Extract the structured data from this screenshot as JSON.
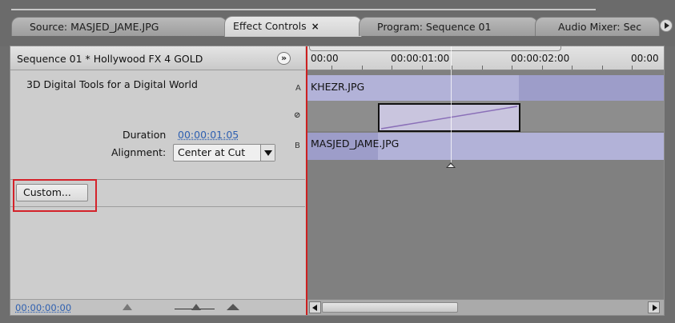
{
  "tabs": [
    {
      "label": "Source: MASJED_JAME.JPG"
    },
    {
      "label": "Effect Controls",
      "close": "×"
    },
    {
      "label": "Program: Sequence 01"
    },
    {
      "label": "Audio Mixer: Sec"
    }
  ],
  "effect_header": {
    "label": "Sequence 01 * Hollywood FX 4 GOLD",
    "toggle_glyph": "»"
  },
  "effect": {
    "description": "3D Digital Tools for a Digital World",
    "duration_label": "Duration",
    "duration_value": "00:00:01:05",
    "alignment_label": "Alignment:",
    "alignment_value": "Center at Cut",
    "custom_button": "Custom...",
    "track_letters": {
      "a": "A",
      "b": "B"
    }
  },
  "timeline": {
    "ruler_labels": [
      "00:00",
      "00:00:01:00",
      "00:00:02:00",
      "00:00"
    ],
    "clip_a": "KHEZR.JPG",
    "clip_b": "MASJED_JAME.JPG"
  },
  "footer": {
    "timecode": "00:00:00:00"
  },
  "colors": {
    "clip_fill": "#b2b2d8",
    "highlight_box": "#d4222a",
    "timecode_link": "#2d5fb0"
  }
}
